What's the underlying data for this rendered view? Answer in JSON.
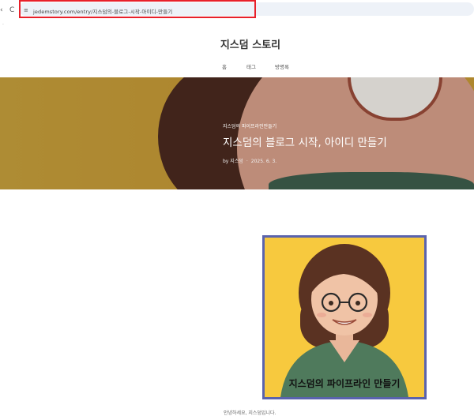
{
  "browser": {
    "back_glyph": "‹",
    "reload_glyph": "C",
    "site_icon": "tune-icon",
    "site_icon_glyph": "≡",
    "url": "jedemstory.com/entry/지스덤의-블로그-시작-아이디-만들기"
  },
  "site": {
    "title": "지스덤 스토리"
  },
  "menu": {
    "home": "홈",
    "tag": "태그",
    "guestbook": "방명록"
  },
  "hero": {
    "category": "지스덤의 파이프라인만들기",
    "title": "지스덤의 블로그 시작, 아이디 만들기",
    "author": "by 지스덤",
    "date": "2025. 6. 3."
  },
  "card": {
    "label": "지스덤의 파이프라인 만들기"
  },
  "footer": {
    "text": "안녕하세요, 지스덤입니다."
  },
  "colors": {
    "highlight_border": "#e8202a",
    "card_border": "#5a63ad",
    "card_bg": "#f7c93e",
    "hero_left": "#c7a03c"
  }
}
